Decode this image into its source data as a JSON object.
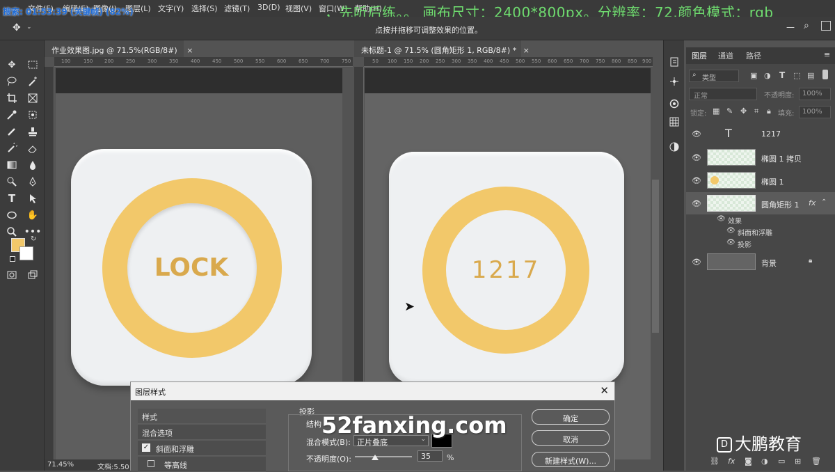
{
  "menubar": {
    "items": [
      "文件(F)",
      "编辑(E)",
      "图像(I)",
      "图层(L)",
      "文字(Y)",
      "选择(S)",
      "滤镜(T)",
      "3D(D)",
      "视图(V)",
      "窗口(W)",
      "帮助(H)"
    ],
    "overlay_status": "搜索: 01:53:39 (关键帧) (82%)",
    "banner": "，先听后练。。 画布尺寸：2400*800px。分辨率：72.颜色模式：rgb"
  },
  "options_bar": {
    "hint": "点按并拖移可调整效果的位置。"
  },
  "documents": [
    {
      "tab": "作业效果图.jpg @ 71.5%(RGB/8#)",
      "ruler_ticks": [
        "100",
        "150",
        "200",
        "250",
        "300",
        "350",
        "400",
        "450",
        "500",
        "550",
        "600",
        "650",
        "700",
        "750"
      ],
      "card_text": "LOCK"
    },
    {
      "tab": "未标题-1 @ 71.5% (圆角矩形 1, RGB/8#) *",
      "ruler_ticks": [
        "50",
        "100",
        "150",
        "200",
        "250",
        "300",
        "350",
        "400",
        "450",
        "500",
        "550",
        "600",
        "650",
        "700",
        "750",
        "800",
        "850",
        "900"
      ],
      "card_text": "1217"
    }
  ],
  "layers_panel": {
    "tabs": [
      "图层",
      "通道",
      "路径"
    ],
    "filter_label": "类型",
    "blend_mode": "正常",
    "opacity_label": "不透明度:",
    "opacity_value": "100%",
    "lock_label": "锁定:",
    "fill_label": "填充:",
    "fill_value": "100%",
    "layers": [
      {
        "name": "1217",
        "kind": "text"
      },
      {
        "name": "椭圆 1 拷贝",
        "kind": "shape"
      },
      {
        "name": "椭圆 1",
        "kind": "shape"
      },
      {
        "name": "圆角矩形 1",
        "kind": "shape",
        "fx": "fx"
      },
      {
        "name": "效果",
        "kind": "effect-group"
      },
      {
        "name": "斜面和浮雕",
        "kind": "effect"
      },
      {
        "name": "投影",
        "kind": "effect"
      },
      {
        "name": "背景",
        "kind": "background"
      }
    ]
  },
  "dialog": {
    "title": "图层样式",
    "list": [
      "样式",
      "混合选项",
      "斜面和浮雕",
      "等高线"
    ],
    "section_title": "投影",
    "subsection": "结构",
    "blend_label": "混合模式(B):",
    "blend_value": "正片叠底",
    "opacity_label": "不透明度(O):",
    "opacity_value": "35",
    "percent": "%",
    "buttons": [
      "确定",
      "取消",
      "新建样式(W)..."
    ]
  },
  "statusbar": {
    "zoom": "71.45%",
    "doc": "文档:5.50"
  },
  "watermark": "52fanxing.com",
  "brand": "大鹏教育"
}
